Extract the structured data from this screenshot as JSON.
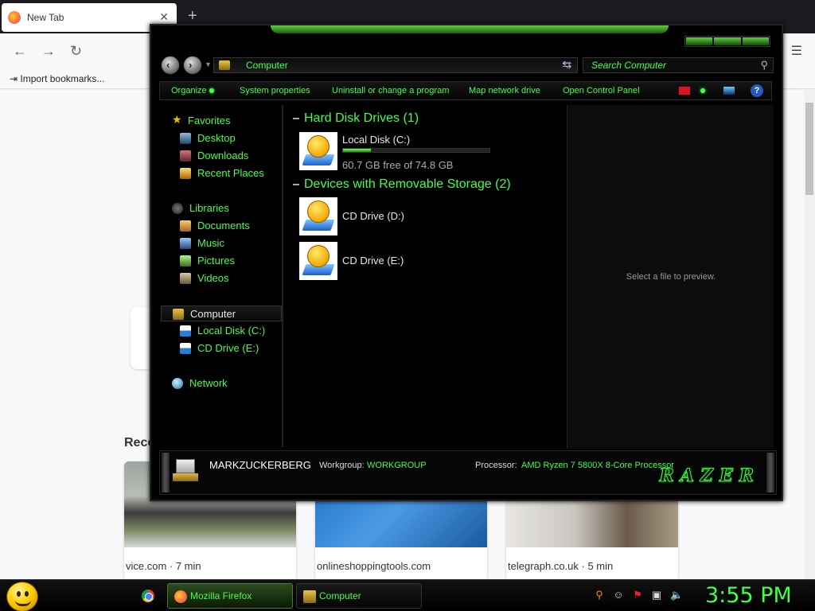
{
  "firefox": {
    "tab_title": "New Tab",
    "bookmark": "Import bookmarks...",
    "recent_heading": "Reco",
    "cards": [
      {
        "caption": "vice.com · 7 min"
      },
      {
        "caption": "onlineshoppingtools.com"
      },
      {
        "caption": "telegraph.co.uk · 5 min"
      }
    ]
  },
  "explorer": {
    "address": "Computer",
    "search_placeholder": "Search Computer",
    "commands": [
      "Organize",
      "System properties",
      "Uninstall or change a program",
      "Map network drive",
      "Open Control Panel"
    ],
    "nav": {
      "favorites": "Favorites",
      "desktop": "Desktop",
      "downloads": "Downloads",
      "recent_places": "Recent Places",
      "libraries": "Libraries",
      "documents": "Documents",
      "music": "Music",
      "pictures": "Pictures",
      "videos": "Videos",
      "computer": "Computer",
      "local_disk": "Local Disk (C:)",
      "cd_drive": "CD Drive (E:)",
      "network": "Network"
    },
    "groups": {
      "hard_disks": "Hard Disk Drives (1)",
      "removable": "Devices with Removable Storage (2)"
    },
    "drives": [
      {
        "name": "Local Disk (C:)",
        "free": "60.7 GB free of 74.8 GB",
        "used_fraction": 0.19
      },
      {
        "name": "CD Drive (D:)"
      },
      {
        "name": "CD Drive (E:)"
      }
    ],
    "preview_text": "Select a file to preview.",
    "details": {
      "computer_name": "MARKZUCKERBERG",
      "workgroup_label": "Workgroup:",
      "workgroup": "WORKGROUP",
      "processor_label": "Processor:",
      "processor": "AMD Ryzen 7 5800X 8-Core Processor",
      "brand": "RAZER"
    },
    "accent_color": "#43ff4a"
  },
  "taskbar": {
    "firefox_label": "Mozilla Firefox",
    "computer_label": "Computer",
    "clock": "3:55 PM"
  }
}
